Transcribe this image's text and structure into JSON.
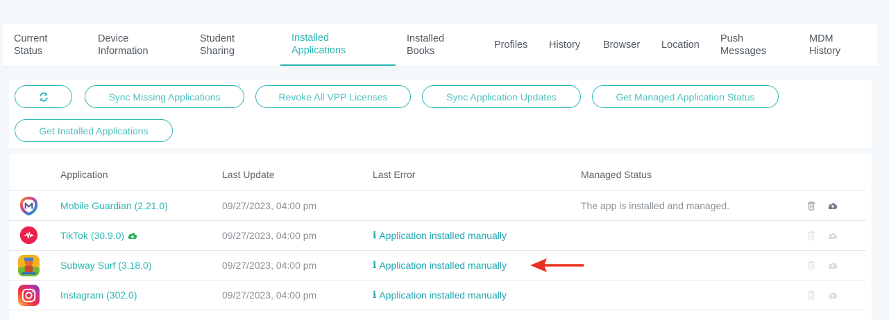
{
  "tabs": [
    {
      "lines": [
        "Current",
        "Status"
      ]
    },
    {
      "lines": [
        "Device",
        "Information"
      ]
    },
    {
      "lines": [
        "Student",
        "Sharing"
      ]
    },
    {
      "lines": [
        "Installed",
        "Applications"
      ]
    },
    {
      "lines": [
        "Installed",
        "Books"
      ]
    },
    {
      "lines": [
        "Profiles"
      ]
    },
    {
      "lines": [
        "History"
      ]
    },
    {
      "lines": [
        "Browser"
      ]
    },
    {
      "lines": [
        "Location"
      ]
    },
    {
      "lines": [
        "Push",
        "Messages"
      ]
    },
    {
      "lines": [
        "MDM",
        "History"
      ]
    }
  ],
  "active_tab": "Installed Applications",
  "buttons": {
    "refresh_icon": "refresh-icon",
    "sync_missing": "Sync Missing Applications",
    "revoke_vpp": "Revoke All VPP Licenses",
    "sync_updates": "Sync Application Updates",
    "get_managed_status": "Get Managed Application Status",
    "get_installed": "Get Installed Applications"
  },
  "table": {
    "headers": {
      "application": "Application",
      "last_update": "Last Update",
      "last_error": "Last Error",
      "managed_status": "Managed Status"
    },
    "rows": [
      {
        "icon": "mobile-guardian-icon",
        "name": "Mobile Guardian (2.21.0)",
        "has_cloud_badge": false,
        "last_update": "09/27/2023, 04:00 pm",
        "last_error": "",
        "managed_status": "The app is installed and managed.",
        "actions_enabled": true
      },
      {
        "icon": "tiktok-icon",
        "name": "TikTok (30.9.0)",
        "has_cloud_badge": true,
        "last_update": "09/27/2023, 04:00 pm",
        "last_error": "Application installed manually",
        "managed_status": "",
        "actions_enabled": false
      },
      {
        "icon": "subway-surf-icon",
        "name": "Subway Surf (3.18.0)",
        "has_cloud_badge": false,
        "last_update": "09/27/2023, 04:00 pm",
        "last_error": "Application installed manually",
        "managed_status": "",
        "actions_enabled": false
      },
      {
        "icon": "instagram-icon",
        "name": "Instagram (302.0)",
        "has_cloud_badge": false,
        "last_update": "09/27/2023, 04:00 pm",
        "last_error": "Application installed manually",
        "managed_status": "",
        "actions_enabled": false
      }
    ]
  },
  "colors": {
    "accent": "#2bb7b3",
    "annotation_arrow": "#e8321f",
    "cloud_badge": "#2bb35a"
  }
}
